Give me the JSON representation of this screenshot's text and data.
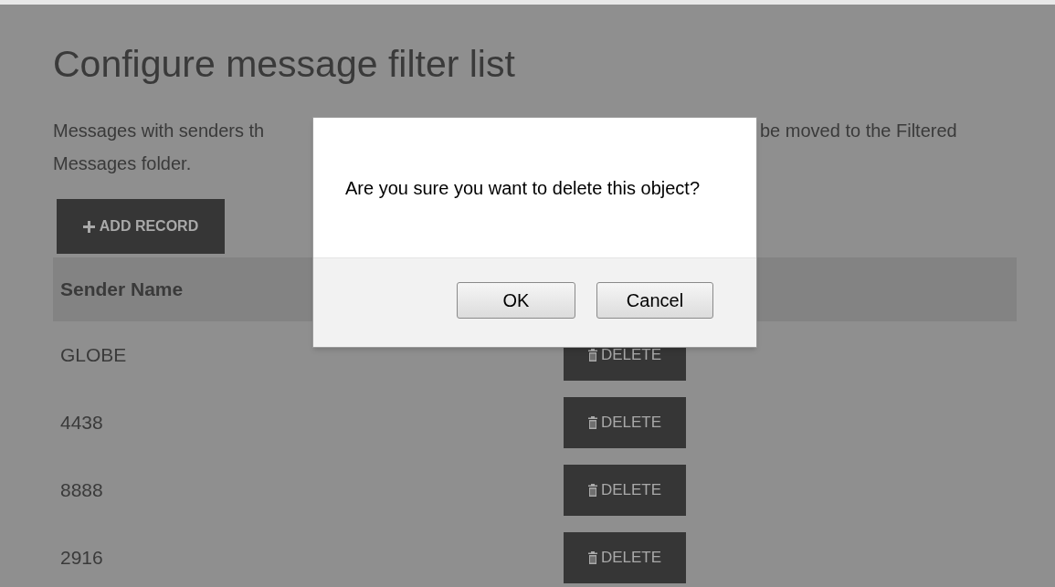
{
  "page": {
    "title": "Configure message filter list",
    "description": {
      "line_1_left": "Messages with senders th",
      "line_1_right": "be moved to the Filtered",
      "line_2": "Messages folder."
    },
    "add_button": "ADD RECORD"
  },
  "table": {
    "columns": [
      "Sender Name"
    ],
    "rows": [
      {
        "sender_name": "GLOBE",
        "action": "DELETE"
      },
      {
        "sender_name": "4438",
        "action": "DELETE"
      },
      {
        "sender_name": "8888",
        "action": "DELETE"
      },
      {
        "sender_name": "2916",
        "action": "DELETE"
      }
    ]
  },
  "dialog": {
    "message": "Are you sure you want to delete this object?",
    "buttons": [
      "OK",
      "Cancel"
    ]
  }
}
